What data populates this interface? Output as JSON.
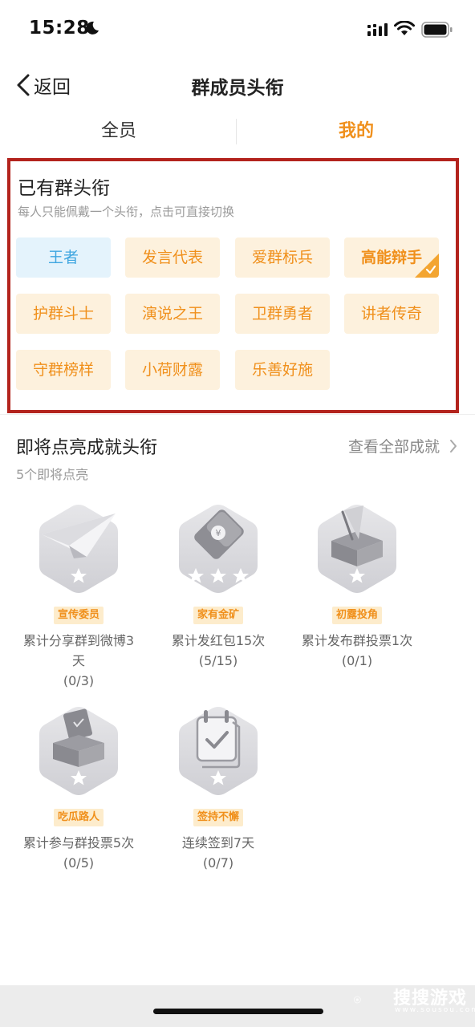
{
  "status_bar": {
    "time": "15:28"
  },
  "nav": {
    "back_label": "返回",
    "title": "群成员头衔"
  },
  "tabs": [
    {
      "label": "全员",
      "active": false
    },
    {
      "label": "我的",
      "active": true
    }
  ],
  "owned": {
    "title": "已有群头衔",
    "subtitle": "每人只能佩戴一个头衔，点击可直接切换",
    "chips": [
      {
        "label": "王者",
        "style": "blue"
      },
      {
        "label": "发言代表",
        "style": "orange"
      },
      {
        "label": "爱群标兵",
        "style": "orange"
      },
      {
        "label": "高能辩手",
        "style": "orange-selected"
      },
      {
        "label": "护群斗士",
        "style": "orange"
      },
      {
        "label": "演说之王",
        "style": "orange"
      },
      {
        "label": "卫群勇者",
        "style": "orange"
      },
      {
        "label": "讲者传奇",
        "style": "orange"
      },
      {
        "label": "守群榜样",
        "style": "orange"
      },
      {
        "label": "小荷财露",
        "style": "orange"
      },
      {
        "label": "乐善好施",
        "style": "orange"
      }
    ]
  },
  "upcoming": {
    "title": "即将点亮成就头衔",
    "view_all": "查看全部成就",
    "subtitle": "5个即将点亮",
    "badges": [
      {
        "icon": "paper-plane-icon",
        "stars": 1,
        "tag": "宣传委员",
        "desc": "累计分享群到微博3天",
        "progress": "(0/3)"
      },
      {
        "icon": "red-envelope-icon",
        "stars": 3,
        "tag": "家有金矿",
        "desc": "累计发红包15次",
        "progress": "(5/15)"
      },
      {
        "icon": "ballot-box-icon",
        "stars": 1,
        "tag": "初露投角",
        "desc": "累计发布群投票1次",
        "progress": "(0/1)"
      },
      {
        "icon": "vote-box-icon",
        "stars": 1,
        "tag": "吃瓜路人",
        "desc": "累计参与群投票5次",
        "progress": "(0/5)"
      },
      {
        "icon": "calendar-check-icon",
        "stars": 1,
        "tag": "签持不懈",
        "desc": "连续签到7天",
        "progress": "(0/7)"
      }
    ]
  },
  "watermark": {
    "text": "搜搜游戏",
    "sub": "www.sousou.com"
  },
  "colors": {
    "accent": "#f0901c",
    "chip_bg": "#fdf1dd",
    "blue": "#3fa6e0",
    "highlight_border": "#b3231d"
  }
}
